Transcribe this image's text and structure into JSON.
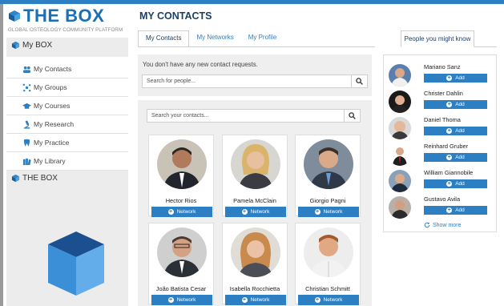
{
  "brand": {
    "logo_bold": "THE BOX",
    "tagline": "GLOBAL OSTEOLOGY COMMUNITY PLATFORM"
  },
  "sidebar": {
    "mybox_title": "My BOX",
    "items": [
      {
        "label": "My Contacts",
        "icon": "people-icon"
      },
      {
        "label": "My Groups",
        "icon": "network-icon"
      },
      {
        "label": "My Courses",
        "icon": "graduation-cap-icon"
      },
      {
        "label": "My Research",
        "icon": "microscope-icon"
      },
      {
        "label": "My Practice",
        "icon": "tooth-icon"
      },
      {
        "label": "My Library",
        "icon": "books-icon"
      }
    ],
    "thebox_title": "THE BOX"
  },
  "main": {
    "title": "MY CONTACTS",
    "tabs": [
      {
        "label": "My Contacts",
        "active": true
      },
      {
        "label": "My Networks",
        "active": false
      },
      {
        "label": "My Profile",
        "active": false
      }
    ],
    "people_tab": "People you might know",
    "requests_msg": "You don't have any new contact requests.",
    "search_people_placeholder": "Search for people...",
    "search_contacts_placeholder": "Search your contacts...",
    "network_label": "Network",
    "contacts": [
      {
        "name": "Hector Rios"
      },
      {
        "name": "Pamela McClain"
      },
      {
        "name": "Giorgio Pagni"
      },
      {
        "name": "João Batista Cesar"
      },
      {
        "name": "Isabella Rocchietta"
      },
      {
        "name": "Christian Schmitt"
      }
    ]
  },
  "suggestions": {
    "add_label": "Add",
    "people": [
      {
        "name": "Mariano Sanz"
      },
      {
        "name": "Christer Dahlin"
      },
      {
        "name": "Daniel Thoma"
      },
      {
        "name": "Reinhard Gruber"
      },
      {
        "name": "William Giannobile"
      },
      {
        "name": "Gustavo Avila"
      }
    ],
    "show_more": "Show more"
  },
  "colors": {
    "accent": "#2c7fc2",
    "title": "#1c3f66",
    "panel": "#ececec"
  }
}
